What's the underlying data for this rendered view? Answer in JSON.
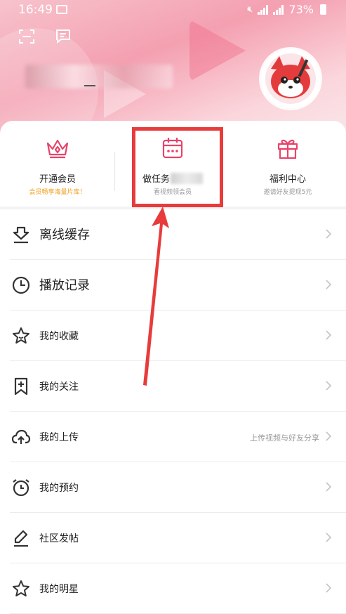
{
  "status_bar": {
    "time": "16:49",
    "battery": "73%"
  },
  "header": {
    "scan_icon": "scan-icon",
    "message_icon": "message-icon",
    "avatar": "fox-avatar"
  },
  "quick_actions": [
    {
      "title": "开通会员",
      "subtitle": "会员畅享海量片库！",
      "icon": "crown-icon",
      "subtitle_color": "#f0a020"
    },
    {
      "title": "做任务",
      "subtitle": "看视频领会员",
      "icon": "calendar-icon",
      "subtitle_color": "#999999"
    },
    {
      "title": "福利中心",
      "subtitle": "邀请好友提现5元",
      "icon": "gift-icon",
      "subtitle_color": "#999999"
    }
  ],
  "menu": [
    {
      "label": "离线缓存",
      "icon": "download-icon",
      "side": ""
    },
    {
      "label": "播放记录",
      "icon": "clock-icon",
      "side": ""
    },
    {
      "label": "我的收藏",
      "icon": "star-icon",
      "side": ""
    },
    {
      "label": "我的关注",
      "icon": "bookmark-plus-icon",
      "side": ""
    },
    {
      "label": "我的上传",
      "icon": "upload-cloud-icon",
      "side": "上传视频与好友分享"
    },
    {
      "label": "我的预约",
      "icon": "alarm-icon",
      "side": ""
    },
    {
      "label": "社区发帖",
      "icon": "pen-icon",
      "side": ""
    },
    {
      "label": "我的明星",
      "icon": "star-icon",
      "side": ""
    }
  ],
  "colors": {
    "accent": "#e8436a",
    "highlight": "#e83b3b"
  }
}
